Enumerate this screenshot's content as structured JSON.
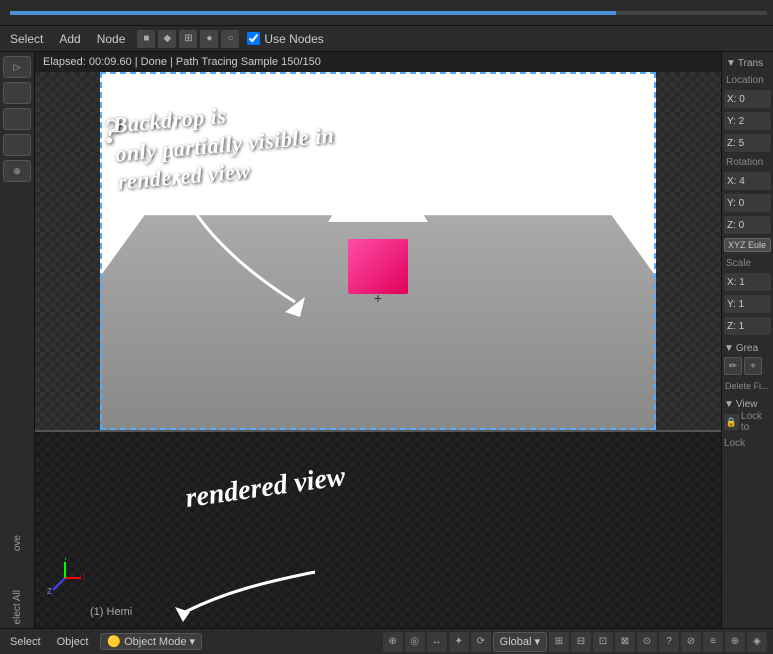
{
  "topbar": {
    "progress_width": "80%"
  },
  "node_header": {
    "select": "Select",
    "add": "Add",
    "node": "Node",
    "use_nodes_label": "Use Nodes",
    "icons": [
      "■",
      "◆",
      "⊞",
      "●",
      "○"
    ]
  },
  "viewport_top": {
    "status_text": "Elapsed: 00:09.60 | Done | Path Tracing Sample 150/150"
  },
  "annotation": {
    "question_mark": "?",
    "main_text_line1": "Backdrop is",
    "main_text_line2": "only partially visible in",
    "main_text_line3": "rendered view"
  },
  "viewport_bottom": {
    "rendered_view_label": "rendered view",
    "hemi_label": "(1) Hemi"
  },
  "right_panel": {
    "trans_label": "Trans",
    "location_label": "Location",
    "loc_x": "X: 0",
    "loc_y": "Y: 2",
    "loc_z": "Z: 5",
    "rotation_label": "Rotation",
    "rot_x": "X: 4",
    "rot_y": "Y: 0",
    "rot_z": "Z: 0",
    "xyz_euler": "XYZ Eule",
    "scale_label": "Scale",
    "scale_x": "X: 1",
    "scale_y": "Y: 1",
    "scale_z": "Z: 1",
    "grease_label": "Grea",
    "view_label": "View",
    "lock_label": "Lock to",
    "lock_icon": "🔒",
    "lock_sub_label": "Lock"
  },
  "bottom_statusbar": {
    "select": "Select",
    "object": "Object",
    "mode": "Object Mode",
    "global": "Global"
  }
}
